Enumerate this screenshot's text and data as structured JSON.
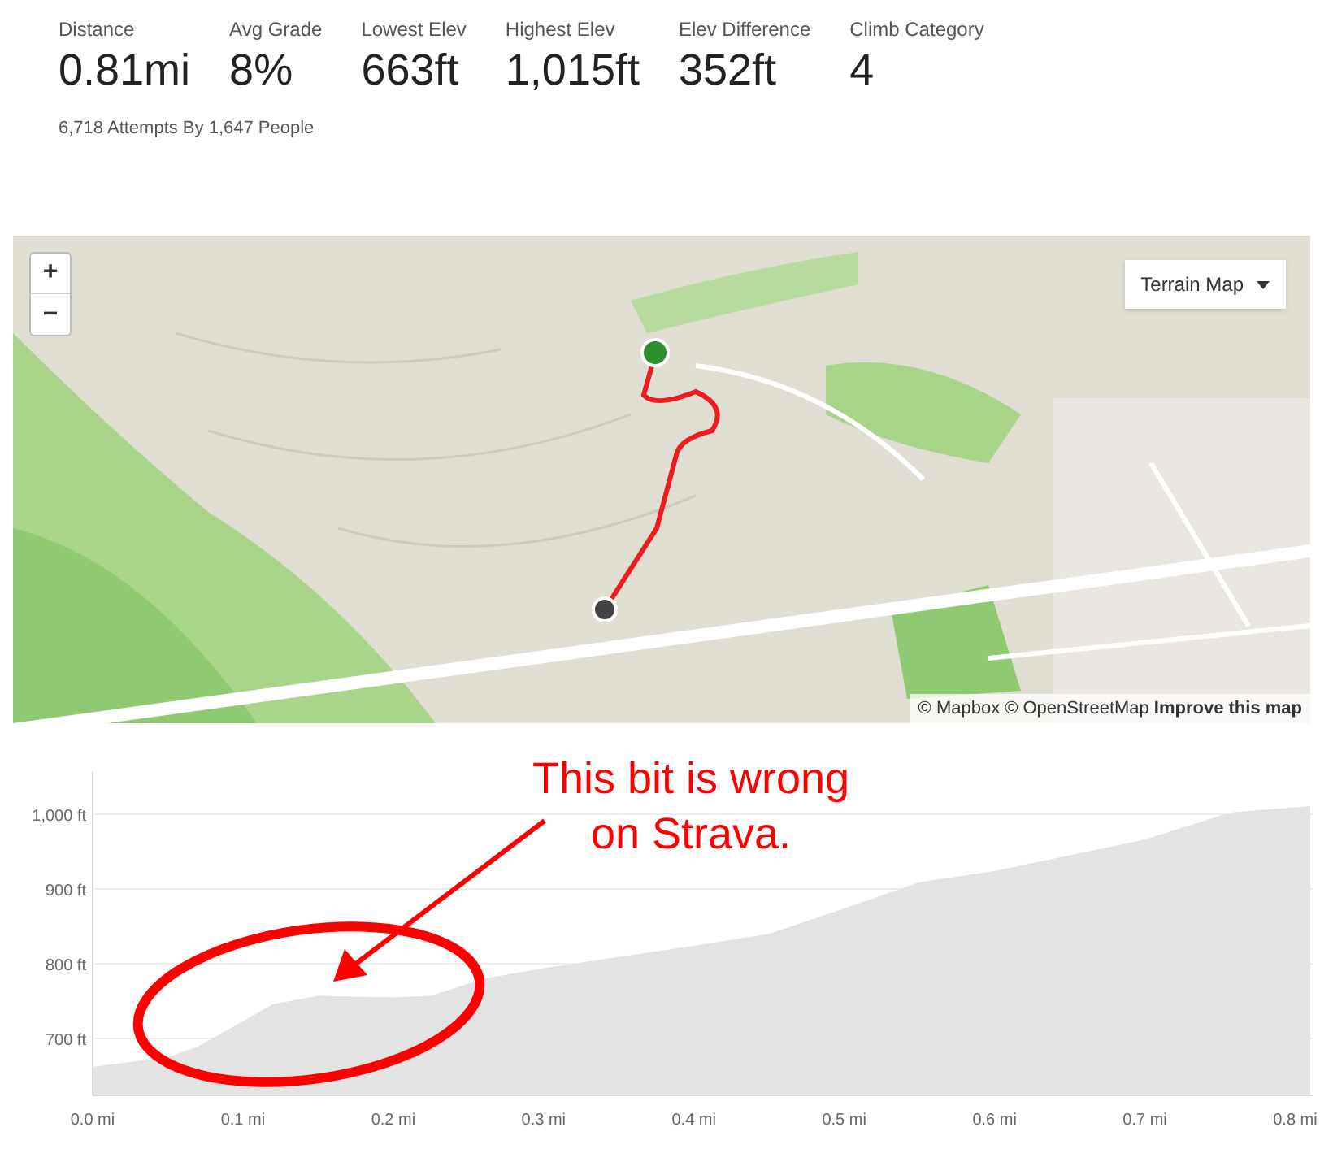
{
  "stats": [
    {
      "label": "Distance",
      "value": "0.81mi"
    },
    {
      "label": "Avg Grade",
      "value": "8%"
    },
    {
      "label": "Lowest Elev",
      "value": "663ft"
    },
    {
      "label": "Highest Elev",
      "value": "1,015ft"
    },
    {
      "label": "Elev Difference",
      "value": "352ft"
    },
    {
      "label": "Climb Category",
      "value": "4"
    }
  ],
  "attempts": "6,718 Attempts By 1,647 People",
  "map": {
    "zoom_in": "+",
    "zoom_out": "−",
    "layer_select": "Terrain Map",
    "attribution": {
      "mapbox": "© Mapbox",
      "osm": "© OpenStreetMap",
      "improve": "Improve this map"
    }
  },
  "elevation_chart": {
    "chart_data": {
      "type": "area",
      "x": [
        0,
        0.05,
        0.07,
        0.12,
        0.15,
        0.2,
        0.225,
        0.26,
        0.3,
        0.4,
        0.45,
        0.5,
        0.55,
        0.6,
        0.7,
        0.75,
        0.76,
        0.81
      ],
      "grid": true,
      "series": [
        {
          "color": "#e3e3e3",
          "values": [
            662,
            675,
            689,
            746,
            757,
            755,
            757,
            780,
            794,
            824,
            840,
            874,
            909,
            924,
            966,
            998,
            1003,
            1011
          ]
        }
      ],
      "xlim": [
        0,
        0.81
      ],
      "ylim": [
        624,
        1057
      ],
      "xticks": [
        {
          "value": 0,
          "label": "0.0 mi"
        },
        {
          "value": 0.1,
          "label": "0.1 mi"
        },
        {
          "value": 0.2,
          "label": "0.2 mi"
        },
        {
          "value": 0.3,
          "label": "0.3 mi"
        },
        {
          "value": 0.4,
          "label": "0.4 mi"
        },
        {
          "value": 0.5,
          "label": "0.5 mi"
        },
        {
          "value": 0.6,
          "label": "0.6 mi"
        },
        {
          "value": 0.7,
          "label": "0.7 mi"
        },
        {
          "value": 0.8,
          "label": "0.8 mi"
        }
      ],
      "yticks": [
        {
          "value": 700,
          "label": "700 ft"
        },
        {
          "value": 800,
          "label": "800 ft"
        },
        {
          "value": 900,
          "label": "900 ft"
        },
        {
          "value": 1000,
          "label": "1,000 ft"
        }
      ]
    }
  },
  "annotation": {
    "lines": [
      "This bit is wrong",
      "on Strava."
    ],
    "color": "#ff0000"
  }
}
